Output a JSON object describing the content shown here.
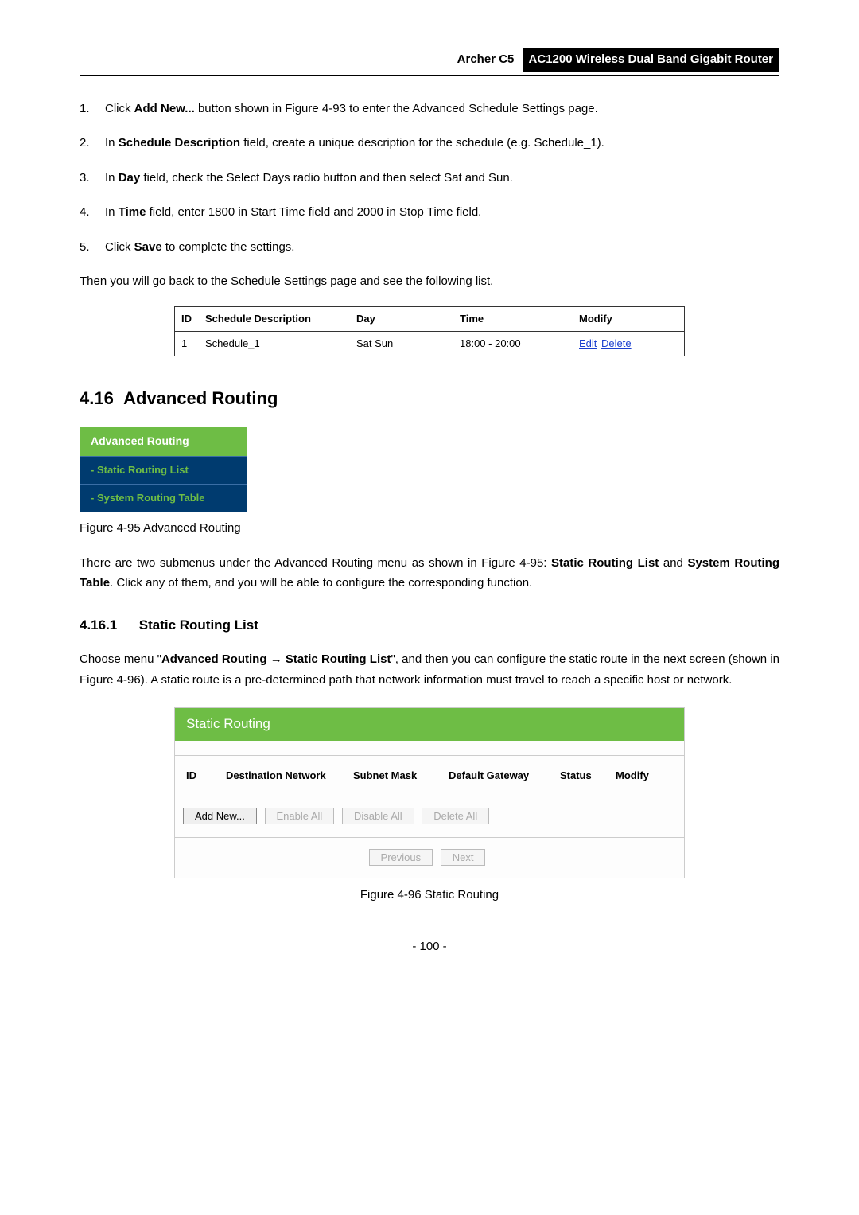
{
  "header": {
    "model": "Archer C5",
    "product": "AC1200 Wireless Dual Band Gigabit Router"
  },
  "steps": [
    {
      "num": "1.",
      "pre": "Click ",
      "bold": "Add New...",
      "post": " button shown in Figure 4-93 to enter the Advanced Schedule Settings page."
    },
    {
      "num": "2.",
      "pre": "In ",
      "bold": "Schedule Description",
      "post": " field, create a unique description for the schedule (e.g. Schedule_1)."
    },
    {
      "num": "3.",
      "pre": "In ",
      "bold": "Day",
      "post": " field, check the Select Days radio button and then select Sat and Sun."
    },
    {
      "num": "4.",
      "pre": "In ",
      "bold": "Time",
      "post": " field, enter 1800 in Start Time field and 2000 in Stop Time field."
    },
    {
      "num": "5.",
      "pre": "Click ",
      "bold": "Save",
      "post": " to complete the settings."
    }
  ],
  "after_steps": "Then you will go back to the Schedule Settings page and see the following list.",
  "sched_table": {
    "headers": {
      "id": "ID",
      "desc": "Schedule Description",
      "day": "Day",
      "time": "Time",
      "mod": "Modify"
    },
    "row": {
      "id": "1",
      "desc": "Schedule_1",
      "day": "Sat Sun",
      "time": "18:00 - 20:00",
      "edit": "Edit",
      "delete": "Delete"
    }
  },
  "section": {
    "num": "4.16",
    "title": "Advanced Routing"
  },
  "menu": {
    "header": "Advanced Routing",
    "item1": "- Static Routing List",
    "item2": "- System Routing Table"
  },
  "fig95": "Figure 4-95 Advanced Routing",
  "para_after_menu": {
    "t1": "There are two submenus under the Advanced Routing menu as shown in Figure 4-95: ",
    "b1": "Static Routing List",
    "t2": " and ",
    "b2": "System Routing Table",
    "t3": ". Click any of them, and you will be able to configure the corresponding function."
  },
  "subsection": {
    "num": "4.16.1",
    "title": "Static Routing List"
  },
  "para_srl": {
    "t1": "Choose menu \"",
    "b1": "Advanced Routing",
    "arrow": " → ",
    "b2": "Static Routing List",
    "t2": "\", and then you can configure the static route in the next screen (shown in Figure 4-96). A static route is a pre-determined path that network information must travel to reach a specific host or network."
  },
  "sr": {
    "title": "Static Routing",
    "cols": {
      "id": "ID",
      "dest": "Destination Network",
      "mask": "Subnet Mask",
      "gw": "Default Gateway",
      "status": "Status",
      "modify": "Modify"
    },
    "btns": {
      "add": "Add New...",
      "enable": "Enable All",
      "disable": "Disable All",
      "delete": "Delete All",
      "prev": "Previous",
      "next": "Next"
    }
  },
  "fig96": "Figure 4-96 Static Routing",
  "page_num": "- 100 -"
}
